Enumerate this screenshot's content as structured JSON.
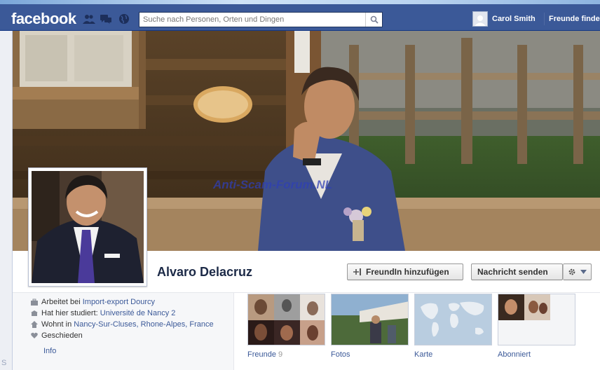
{
  "header": {
    "logo": "facebook",
    "search_placeholder": "Suche nach Personen, Orten und Dingen",
    "user_name": "Carol Smith",
    "friends_link": "Freunde finden"
  },
  "cover": {
    "watermark": "Anti-Scam-Forum.NL"
  },
  "profile": {
    "name": "Alvaro Delacruz",
    "add_friend_label": "FreundIn hinzufügen",
    "message_label": "Nachricht senden"
  },
  "about": {
    "work_prefix": "Arbeitet bei",
    "work_value": "Import-export Dourcy",
    "study_prefix": "Hat hier studiert:",
    "study_value": "Université de Nancy 2",
    "home_prefix": "Wohnt in",
    "home_value": "Nancy-Sur-Cluses, Rhone-Alpes, France",
    "relationship": "Geschieden",
    "info_link": "Info"
  },
  "tiles": {
    "friends_label": "Freunde",
    "friends_count": "9",
    "photos_label": "Fotos",
    "map_label": "Karte",
    "subscribed_label": "Abonniert"
  },
  "gutter": {
    "text": "S"
  },
  "colors": {
    "brand": "#3b5998",
    "link": "#3b5998",
    "name": "#1c2a47"
  }
}
